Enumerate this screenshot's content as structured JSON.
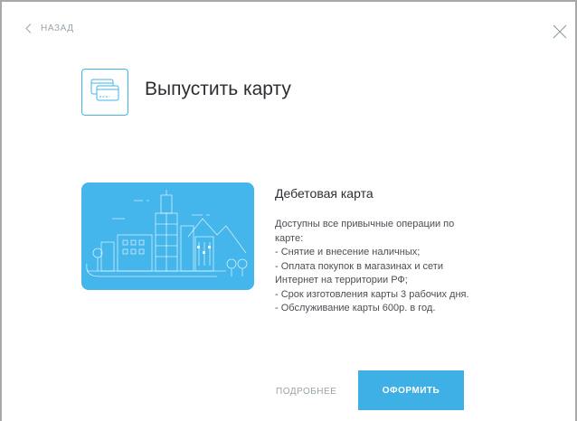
{
  "header": {
    "back_label": "НАЗАД",
    "back_icon": "chevron-left-icon",
    "close_icon": "close-icon"
  },
  "title": {
    "icon": "cards-icon",
    "text": "Выпустить карту"
  },
  "card": {
    "illustration_icon": "city-illustration",
    "title": "Дебетовая карта",
    "description_lines": [
      "Доступны все привычные операции по",
      "карте:",
      "- Снятие и внесение наличных;",
      "- Оплата покупок в магазинах и сети",
      "Интернет на территории РФ;",
      "- Срок изготовления карты 3 рабочих дня.",
      "- Обслуживание карты 600р. в год."
    ]
  },
  "actions": {
    "more_label": "ПОДРОБНЕЕ",
    "apply_label": "ОФОРМИТЬ"
  },
  "colors": {
    "accent": "#3fb0e5",
    "card_bg": "#44b6ec",
    "text_main": "#2b2f33",
    "text_muted": "#9aa3ab"
  }
}
